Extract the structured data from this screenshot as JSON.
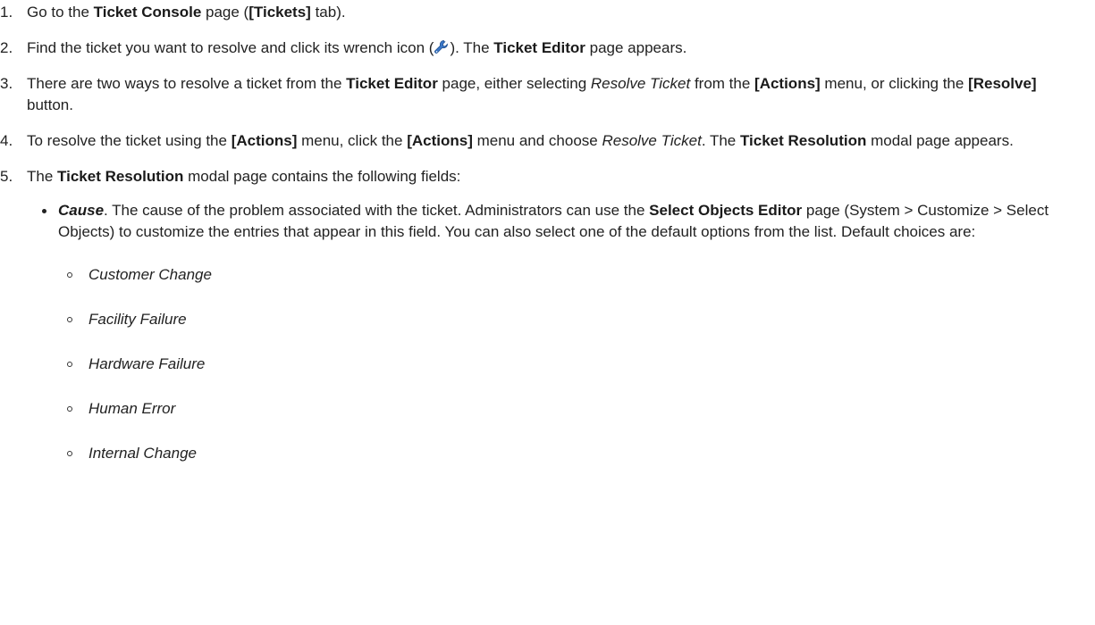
{
  "steps": [
    {
      "num": "1.",
      "parts": [
        {
          "t": "Go to the "
        },
        {
          "t": "Ticket Console",
          "s": "b"
        },
        {
          "t": " page ("
        },
        {
          "t": "[Tickets]",
          "s": "b"
        },
        {
          "t": " tab)."
        }
      ]
    },
    {
      "num": "2.",
      "parts": [
        {
          "t": "Find the ticket you want to resolve and click its wrench icon ("
        },
        {
          "icon": "wrench-icon"
        },
        {
          "t": "). The "
        },
        {
          "t": "Ticket Editor",
          "s": "b"
        },
        {
          "t": " page appears."
        }
      ]
    },
    {
      "num": "3.",
      "parts": [
        {
          "t": "There are two ways to resolve a ticket from the "
        },
        {
          "t": "Ticket Editor",
          "s": "b"
        },
        {
          "t": " page, either selecting "
        },
        {
          "t": "Resolve Ticket",
          "s": "i"
        },
        {
          "t": " from the "
        },
        {
          "t": "[Actions]",
          "s": "b"
        },
        {
          "t": " menu, or clicking the "
        },
        {
          "t": "[Resolve]",
          "s": "b"
        },
        {
          "t": " button."
        }
      ]
    },
    {
      "num": "4.",
      "parts": [
        {
          "t": "To resolve the ticket using the "
        },
        {
          "t": "[Actions]",
          "s": "b"
        },
        {
          "t": " menu, click the "
        },
        {
          "t": "[Actions]",
          "s": "b"
        },
        {
          "t": " menu and choose "
        },
        {
          "t": "Resolve Ticket",
          "s": "i"
        },
        {
          "t": ". The "
        },
        {
          "t": "Ticket Resolution",
          "s": "b"
        },
        {
          "t": " modal page appears."
        }
      ]
    },
    {
      "num": "5.",
      "parts": [
        {
          "t": "The "
        },
        {
          "t": "Ticket Resolution",
          "s": "b"
        },
        {
          "t": " modal page contains the following fields:"
        }
      ],
      "bullets": [
        {
          "parts": [
            {
              "t": "Cause",
              "s": "bi"
            },
            {
              "t": ". The cause of the problem associated with the ticket. Administrators can use the "
            },
            {
              "t": "Select Objects Editor",
              "s": "b"
            },
            {
              "t": " page (System > Customize > Select Objects) to customize the entries that appear in this field. You can also select one of the default options from the list. Default choices are:"
            }
          ],
          "sub_items": [
            "Customer Change",
            "Facility Failure",
            "Hardware Failure",
            "Human Error",
            "Internal Change"
          ]
        }
      ]
    }
  ],
  "colors": {
    "text": "#222222",
    "wrench_blue": "#3b78c9",
    "wrench_dark": "#1f4f8f"
  }
}
